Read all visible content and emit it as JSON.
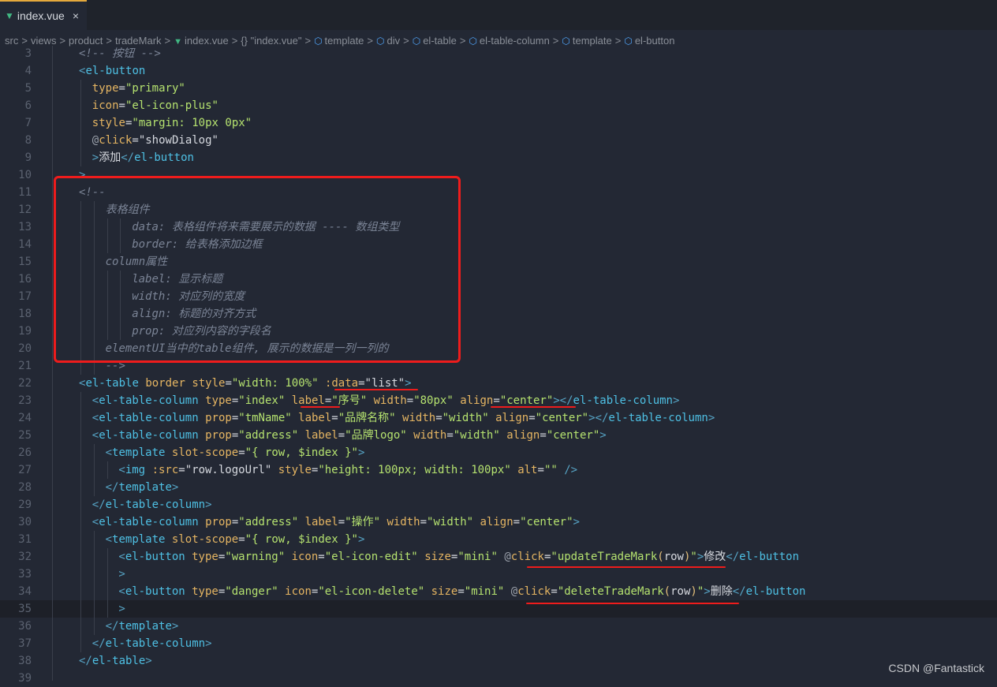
{
  "tab": {
    "label": "index.vue",
    "close_icon": "×",
    "file_icon": "vue-icon"
  },
  "breadcrumb": [
    {
      "label": "src",
      "icon": ""
    },
    {
      "label": "views",
      "icon": ""
    },
    {
      "label": "product",
      "icon": ""
    },
    {
      "label": "tradeMark",
      "icon": ""
    },
    {
      "label": "index.vue",
      "icon": "vue-icon"
    },
    {
      "label": "{} \"index.vue\"",
      "icon": ""
    },
    {
      "label": "template",
      "icon": "cube-icon"
    },
    {
      "label": "div",
      "icon": "cube-icon"
    },
    {
      "label": "el-table",
      "icon": "cube-icon"
    },
    {
      "label": "el-table-column",
      "icon": "cube-icon"
    },
    {
      "label": "template",
      "icon": "cube-icon"
    },
    {
      "label": "el-button",
      "icon": "cube-icon"
    }
  ],
  "current_line": 35,
  "lines": [
    {
      "n": 3,
      "indent": 0,
      "tokens": [
        [
          "cmt",
          "<!-- 按钮 -->"
        ]
      ]
    },
    {
      "n": 4,
      "indent": 0,
      "tokens": [
        [
          "punc",
          "<"
        ],
        [
          "tag",
          "el-button"
        ]
      ]
    },
    {
      "n": 5,
      "indent": 2,
      "tokens": [
        [
          "attr",
          "type"
        ],
        [
          "eq",
          "="
        ],
        [
          "str",
          "\"primary\""
        ]
      ]
    },
    {
      "n": 6,
      "indent": 2,
      "tokens": [
        [
          "attr",
          "icon"
        ],
        [
          "eq",
          "="
        ],
        [
          "str",
          "\"el-icon-plus\""
        ]
      ]
    },
    {
      "n": 7,
      "indent": 2,
      "tokens": [
        [
          "attr",
          "style"
        ],
        [
          "eq",
          "="
        ],
        [
          "str",
          "\"margin: 10px 0px\""
        ]
      ]
    },
    {
      "n": 8,
      "indent": 2,
      "tokens": [
        [
          "at",
          "@"
        ],
        [
          "attr",
          "click"
        ],
        [
          "eq",
          "="
        ],
        [
          "text",
          "\"showDialog\""
        ]
      ]
    },
    {
      "n": 9,
      "indent": 2,
      "tokens": [
        [
          "punc",
          ">"
        ],
        [
          "text",
          "添加"
        ],
        [
          "punc",
          "</"
        ],
        [
          "tag",
          "el-button"
        ]
      ]
    },
    {
      "n": 10,
      "indent": 0,
      "tokens": [
        [
          "punc",
          ">"
        ]
      ]
    },
    {
      "n": 11,
      "indent": 0,
      "tokens": [
        [
          "cmt",
          "<!--"
        ]
      ]
    },
    {
      "n": 12,
      "indent": 4,
      "tokens": [
        [
          "cmt",
          "表格组件"
        ]
      ]
    },
    {
      "n": 13,
      "indent": 8,
      "tokens": [
        [
          "cmt",
          "data: 表格组件将来需要展示的数据 ---- 数组类型"
        ]
      ]
    },
    {
      "n": 14,
      "indent": 8,
      "tokens": [
        [
          "cmt",
          "border: 给表格添加边框"
        ]
      ]
    },
    {
      "n": 15,
      "indent": 4,
      "tokens": [
        [
          "cmt",
          "column属性"
        ]
      ]
    },
    {
      "n": 16,
      "indent": 8,
      "tokens": [
        [
          "cmt",
          "label: 显示标题"
        ]
      ]
    },
    {
      "n": 17,
      "indent": 8,
      "tokens": [
        [
          "cmt",
          "width: 对应列的宽度"
        ]
      ]
    },
    {
      "n": 18,
      "indent": 8,
      "tokens": [
        [
          "cmt",
          "align: 标题的对齐方式"
        ]
      ]
    },
    {
      "n": 19,
      "indent": 8,
      "tokens": [
        [
          "cmt",
          "prop: 对应列内容的字段名"
        ]
      ]
    },
    {
      "n": 20,
      "indent": 4,
      "tokens": [
        [
          "cmt",
          "elementUI当中的table组件, 展示的数据是一列一列的"
        ]
      ]
    },
    {
      "n": 21,
      "indent": 4,
      "tokens": [
        [
          "cmt",
          "-->"
        ]
      ]
    },
    {
      "n": 22,
      "indent": 0,
      "tokens": [
        [
          "punc",
          "<"
        ],
        [
          "tag",
          "el-table"
        ],
        [
          "text",
          " "
        ],
        [
          "attr",
          "border"
        ],
        [
          "text",
          " "
        ],
        [
          "attr",
          "style"
        ],
        [
          "eq",
          "="
        ],
        [
          "str",
          "\"width: 100%\""
        ],
        [
          "text",
          " "
        ],
        [
          "attr",
          ":data"
        ],
        [
          "eq",
          "="
        ],
        [
          "text",
          "\"list\""
        ],
        [
          "punc",
          ">"
        ]
      ]
    },
    {
      "n": 23,
      "indent": 2,
      "tokens": [
        [
          "punc",
          "<"
        ],
        [
          "tag",
          "el-table-column"
        ],
        [
          "text",
          " "
        ],
        [
          "attr",
          "type"
        ],
        [
          "eq",
          "="
        ],
        [
          "str",
          "\"index\""
        ],
        [
          "text",
          " "
        ],
        [
          "attr",
          "label"
        ],
        [
          "eq",
          "="
        ],
        [
          "str",
          "\"序号\""
        ],
        [
          "text",
          " "
        ],
        [
          "attr",
          "width"
        ],
        [
          "eq",
          "="
        ],
        [
          "str",
          "\"80px\""
        ],
        [
          "text",
          " "
        ],
        [
          "attr",
          "align"
        ],
        [
          "eq",
          "="
        ],
        [
          "str",
          "\"center\""
        ],
        [
          "punc",
          "></"
        ],
        [
          "tag",
          "el-table-column"
        ],
        [
          "punc",
          ">"
        ]
      ]
    },
    {
      "n": 24,
      "indent": 2,
      "tokens": [
        [
          "punc",
          "<"
        ],
        [
          "tag",
          "el-table-column"
        ],
        [
          "text",
          " "
        ],
        [
          "attr",
          "prop"
        ],
        [
          "eq",
          "="
        ],
        [
          "str",
          "\"tmName\""
        ],
        [
          "text",
          " "
        ],
        [
          "attr",
          "label"
        ],
        [
          "eq",
          "="
        ],
        [
          "str",
          "\"品牌名称\""
        ],
        [
          "text",
          " "
        ],
        [
          "attr",
          "width"
        ],
        [
          "eq",
          "="
        ],
        [
          "str",
          "\"width\""
        ],
        [
          "text",
          " "
        ],
        [
          "attr",
          "align"
        ],
        [
          "eq",
          "="
        ],
        [
          "str",
          "\"center\""
        ],
        [
          "punc",
          "></"
        ],
        [
          "tag",
          "el-table-column"
        ],
        [
          "punc",
          ">"
        ]
      ]
    },
    {
      "n": 25,
      "indent": 2,
      "tokens": [
        [
          "punc",
          "<"
        ],
        [
          "tag",
          "el-table-column"
        ],
        [
          "text",
          " "
        ],
        [
          "attr",
          "prop"
        ],
        [
          "eq",
          "="
        ],
        [
          "str",
          "\"address\""
        ],
        [
          "text",
          " "
        ],
        [
          "attr",
          "label"
        ],
        [
          "eq",
          "="
        ],
        [
          "str",
          "\"品牌logo\""
        ],
        [
          "text",
          " "
        ],
        [
          "attr",
          "width"
        ],
        [
          "eq",
          "="
        ],
        [
          "str",
          "\"width\""
        ],
        [
          "text",
          " "
        ],
        [
          "attr",
          "align"
        ],
        [
          "eq",
          "="
        ],
        [
          "str",
          "\"center\""
        ],
        [
          "punc",
          ">"
        ]
      ]
    },
    {
      "n": 26,
      "indent": 4,
      "tokens": [
        [
          "punc",
          "<"
        ],
        [
          "tag",
          "template"
        ],
        [
          "text",
          " "
        ],
        [
          "attr",
          "slot-scope"
        ],
        [
          "eq",
          "="
        ],
        [
          "str",
          "\"{ row, $index }\""
        ],
        [
          "punc",
          ">"
        ]
      ]
    },
    {
      "n": 27,
      "indent": 6,
      "tokens": [
        [
          "punc",
          "<"
        ],
        [
          "tag",
          "img"
        ],
        [
          "text",
          " "
        ],
        [
          "attr",
          ":src"
        ],
        [
          "eq",
          "="
        ],
        [
          "text",
          "\"row.logoUrl\""
        ],
        [
          "text",
          " "
        ],
        [
          "attr",
          "style"
        ],
        [
          "eq",
          "="
        ],
        [
          "str",
          "\"height: 100px; width: 100px\""
        ],
        [
          "text",
          " "
        ],
        [
          "attr",
          "alt"
        ],
        [
          "eq",
          "="
        ],
        [
          "str",
          "\"\""
        ],
        [
          "text",
          " "
        ],
        [
          "punc",
          "/>"
        ]
      ]
    },
    {
      "n": 28,
      "indent": 4,
      "tokens": [
        [
          "punc",
          "</"
        ],
        [
          "tag",
          "template"
        ],
        [
          "punc",
          ">"
        ]
      ]
    },
    {
      "n": 29,
      "indent": 2,
      "tokens": [
        [
          "punc",
          "</"
        ],
        [
          "tag",
          "el-table-column"
        ],
        [
          "punc",
          ">"
        ]
      ]
    },
    {
      "n": 30,
      "indent": 2,
      "tokens": [
        [
          "punc",
          "<"
        ],
        [
          "tag",
          "el-table-column"
        ],
        [
          "text",
          " "
        ],
        [
          "attr",
          "prop"
        ],
        [
          "eq",
          "="
        ],
        [
          "str",
          "\"address\""
        ],
        [
          "text",
          " "
        ],
        [
          "attr",
          "label"
        ],
        [
          "eq",
          "="
        ],
        [
          "str",
          "\"操作\""
        ],
        [
          "text",
          " "
        ],
        [
          "attr",
          "width"
        ],
        [
          "eq",
          "="
        ],
        [
          "str",
          "\"width\""
        ],
        [
          "text",
          " "
        ],
        [
          "attr",
          "align"
        ],
        [
          "eq",
          "="
        ],
        [
          "str",
          "\"center\""
        ],
        [
          "punc",
          ">"
        ]
      ]
    },
    {
      "n": 31,
      "indent": 4,
      "tokens": [
        [
          "punc",
          "<"
        ],
        [
          "tag",
          "template"
        ],
        [
          "text",
          " "
        ],
        [
          "attr",
          "slot-scope"
        ],
        [
          "eq",
          "="
        ],
        [
          "str",
          "\"{ row, $index }\""
        ],
        [
          "punc",
          ">"
        ]
      ]
    },
    {
      "n": 32,
      "indent": 6,
      "tokens": [
        [
          "punc",
          "<"
        ],
        [
          "tag",
          "el-button"
        ],
        [
          "text",
          " "
        ],
        [
          "attr",
          "type"
        ],
        [
          "eq",
          "="
        ],
        [
          "str",
          "\"warning\""
        ],
        [
          "text",
          " "
        ],
        [
          "attr",
          "icon"
        ],
        [
          "eq",
          "="
        ],
        [
          "str",
          "\"el-icon-edit\""
        ],
        [
          "text",
          " "
        ],
        [
          "attr",
          "size"
        ],
        [
          "eq",
          "="
        ],
        [
          "str",
          "\"mini\""
        ],
        [
          "text",
          " "
        ],
        [
          "at",
          "@"
        ],
        [
          "attr",
          "click"
        ],
        [
          "eq",
          "="
        ],
        [
          "str",
          "\"updateTradeMark"
        ],
        [
          "par",
          "("
        ],
        [
          "text",
          "row"
        ],
        [
          "par",
          ")"
        ],
        [
          "str",
          "\""
        ],
        [
          "punc",
          ">"
        ],
        [
          "text",
          "修改"
        ],
        [
          "punc",
          "</"
        ],
        [
          "tag",
          "el-button"
        ]
      ]
    },
    {
      "n": 33,
      "indent": 6,
      "tokens": [
        [
          "punc",
          ">"
        ]
      ]
    },
    {
      "n": 34,
      "indent": 6,
      "tokens": [
        [
          "punc",
          "<"
        ],
        [
          "tag",
          "el-button"
        ],
        [
          "text",
          " "
        ],
        [
          "attr",
          "type"
        ],
        [
          "eq",
          "="
        ],
        [
          "str",
          "\"danger\""
        ],
        [
          "text",
          " "
        ],
        [
          "attr",
          "icon"
        ],
        [
          "eq",
          "="
        ],
        [
          "str",
          "\"el-icon-delete\""
        ],
        [
          "text",
          " "
        ],
        [
          "attr",
          "size"
        ],
        [
          "eq",
          "="
        ],
        [
          "str",
          "\"mini\""
        ],
        [
          "text",
          " "
        ],
        [
          "at",
          "@"
        ],
        [
          "attr",
          "click"
        ],
        [
          "eq",
          "="
        ],
        [
          "str",
          "\"deleteTradeMark"
        ],
        [
          "par",
          "("
        ],
        [
          "text",
          "row"
        ],
        [
          "par",
          ")"
        ],
        [
          "str",
          "\""
        ],
        [
          "punc",
          ">"
        ],
        [
          "text",
          "删除"
        ],
        [
          "punc",
          "</"
        ],
        [
          "tag",
          "el-button"
        ]
      ]
    },
    {
      "n": 35,
      "indent": 6,
      "tokens": [
        [
          "punc",
          ">"
        ]
      ]
    },
    {
      "n": 36,
      "indent": 4,
      "tokens": [
        [
          "punc",
          "</"
        ],
        [
          "tag",
          "template"
        ],
        [
          "punc",
          ">"
        ]
      ]
    },
    {
      "n": 37,
      "indent": 2,
      "tokens": [
        [
          "punc",
          "</"
        ],
        [
          "tag",
          "el-table-column"
        ],
        [
          "punc",
          ">"
        ]
      ]
    },
    {
      "n": 38,
      "indent": 0,
      "tokens": [
        [
          "punc",
          "</"
        ],
        [
          "tag",
          "el-table"
        ],
        [
          "punc",
          ">"
        ]
      ]
    },
    {
      "n": 39,
      "indent": 0,
      "tokens": []
    }
  ],
  "annotations": {
    "highlight_box_lines": [
      11,
      20
    ],
    "underlined": [
      ":data=\"list\"",
      "label=",
      "align=\"center\"",
      "@click=\"updateTradeMark(row)\"",
      "@click=\"deleteTradeMark(row)\""
    ],
    "color": "#ee1c1c"
  },
  "watermark": "CSDN @Fantastick"
}
